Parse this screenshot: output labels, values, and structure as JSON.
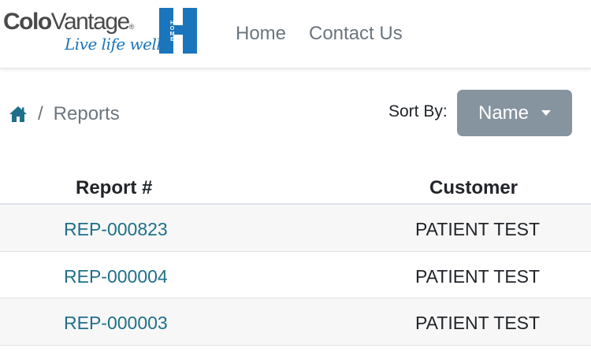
{
  "brand": {
    "name_bold": "Colo",
    "name_light": "Vantage",
    "registered": "®",
    "tagline": "Live life well.",
    "home_badge": "HOME",
    "accent_color": "#1a75bc"
  },
  "nav": {
    "items": [
      {
        "label": "Home"
      },
      {
        "label": "Contact Us"
      }
    ]
  },
  "breadcrumb": {
    "home_icon": "home-icon",
    "separator": "/",
    "current": "Reports"
  },
  "sort": {
    "label": "Sort By:",
    "selected": "Name",
    "button_color": "#8694a0"
  },
  "table": {
    "headers": [
      "Report #",
      "Customer"
    ],
    "rows": [
      {
        "report": "REP-000823",
        "customer": "PATIENT TEST"
      },
      {
        "report": "REP-000004",
        "customer": "PATIENT TEST"
      },
      {
        "report": "REP-000003",
        "customer": "PATIENT TEST"
      }
    ]
  }
}
